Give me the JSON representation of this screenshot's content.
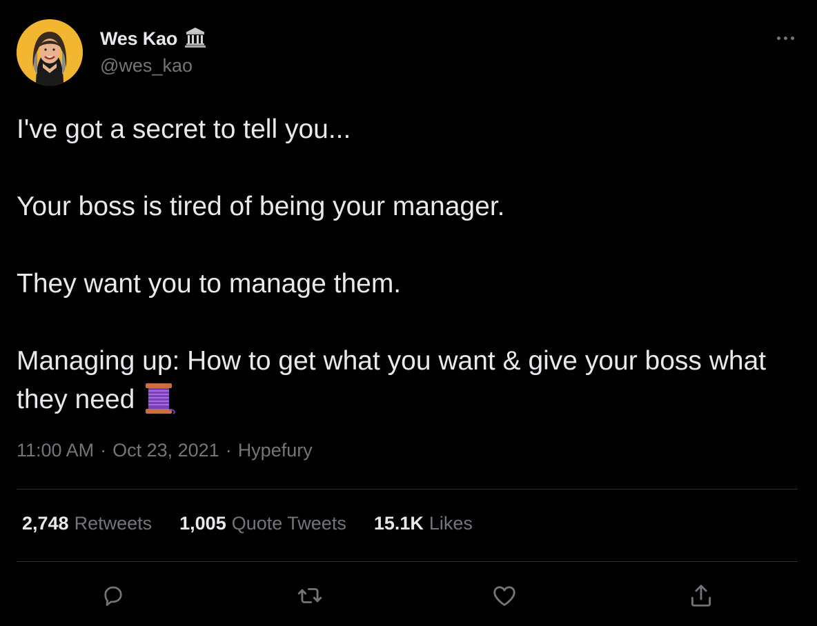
{
  "author": {
    "display_name": "Wes Kao",
    "handle": "@wes_kao",
    "badge_icon": "classical-building-icon",
    "avatar_bg": "#f2b631"
  },
  "tweet": {
    "lines": [
      "I've got a secret to tell you...",
      "Your boss is tired of being your manager.",
      "They want you to manage them.",
      "Managing up: How to get what you want & give your boss what they need"
    ],
    "emoji": "thread-spool-icon"
  },
  "meta": {
    "time": "11:00 AM",
    "date": "Oct 23, 2021",
    "source": "Hypefury",
    "separator": "·"
  },
  "stats": [
    {
      "value": "2,748",
      "label": "Retweets"
    },
    {
      "value": "1,005",
      "label": "Quote Tweets"
    },
    {
      "value": "15.1K",
      "label": "Likes"
    }
  ],
  "actions": [
    "reply-icon",
    "retweet-icon",
    "like-icon",
    "share-icon"
  ],
  "colors": {
    "background": "#000000",
    "text": "#e7e9ea",
    "secondary": "#71767b",
    "divider": "#2f3336"
  }
}
